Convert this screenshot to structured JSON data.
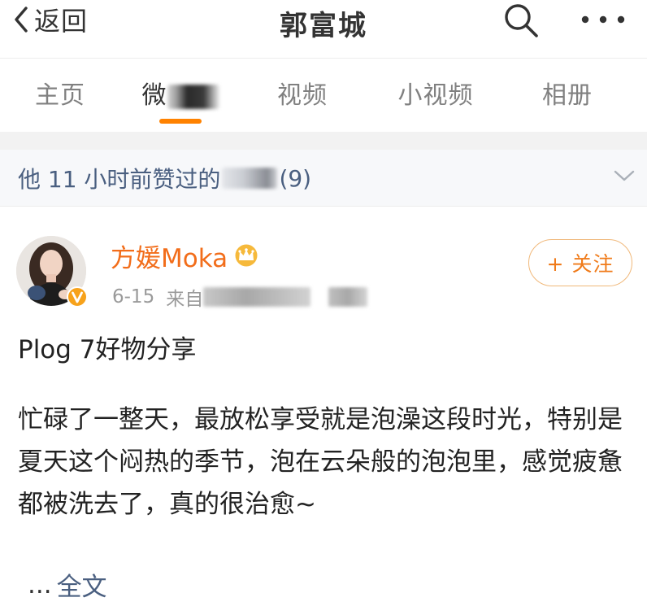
{
  "navbar": {
    "back_label": "返回",
    "title": "郭富城",
    "search_icon": "search-icon",
    "more_icon": "more-dots-icon"
  },
  "tabs": [
    {
      "label": "主页",
      "active": false
    },
    {
      "label": "微",
      "active": true,
      "partially_redacted": true
    },
    {
      "label": "视频",
      "active": false
    },
    {
      "label": "小视频",
      "active": false
    },
    {
      "label": "相册",
      "active": false
    }
  ],
  "liked_bar": {
    "prefix": "他 11 小时前赞过的",
    "suffix": "(9)",
    "chevron_icon": "chevron-down-icon"
  },
  "post": {
    "author": "方媛Moka",
    "badge_icon": "crown-icon",
    "verified_icon": "verified-v-icon",
    "date": "6-15",
    "from_label": "来自",
    "follow_label": "+ 关注",
    "title": "Plog 7好物分享",
    "body": "忙碌了一整天，最放松享受就是泡澡这段时光，特别是夏天这个闷热的季节，泡在云朵般的泡泡里，感觉疲惫都被洗去了，真的很治愈~",
    "ellipsis": "...",
    "read_more": "全文"
  },
  "colors": {
    "accent_orange": "#ff8200",
    "author_orange": "#f26d1a",
    "link_blue": "#4a5f80",
    "follow_border": "#f0b87a"
  }
}
